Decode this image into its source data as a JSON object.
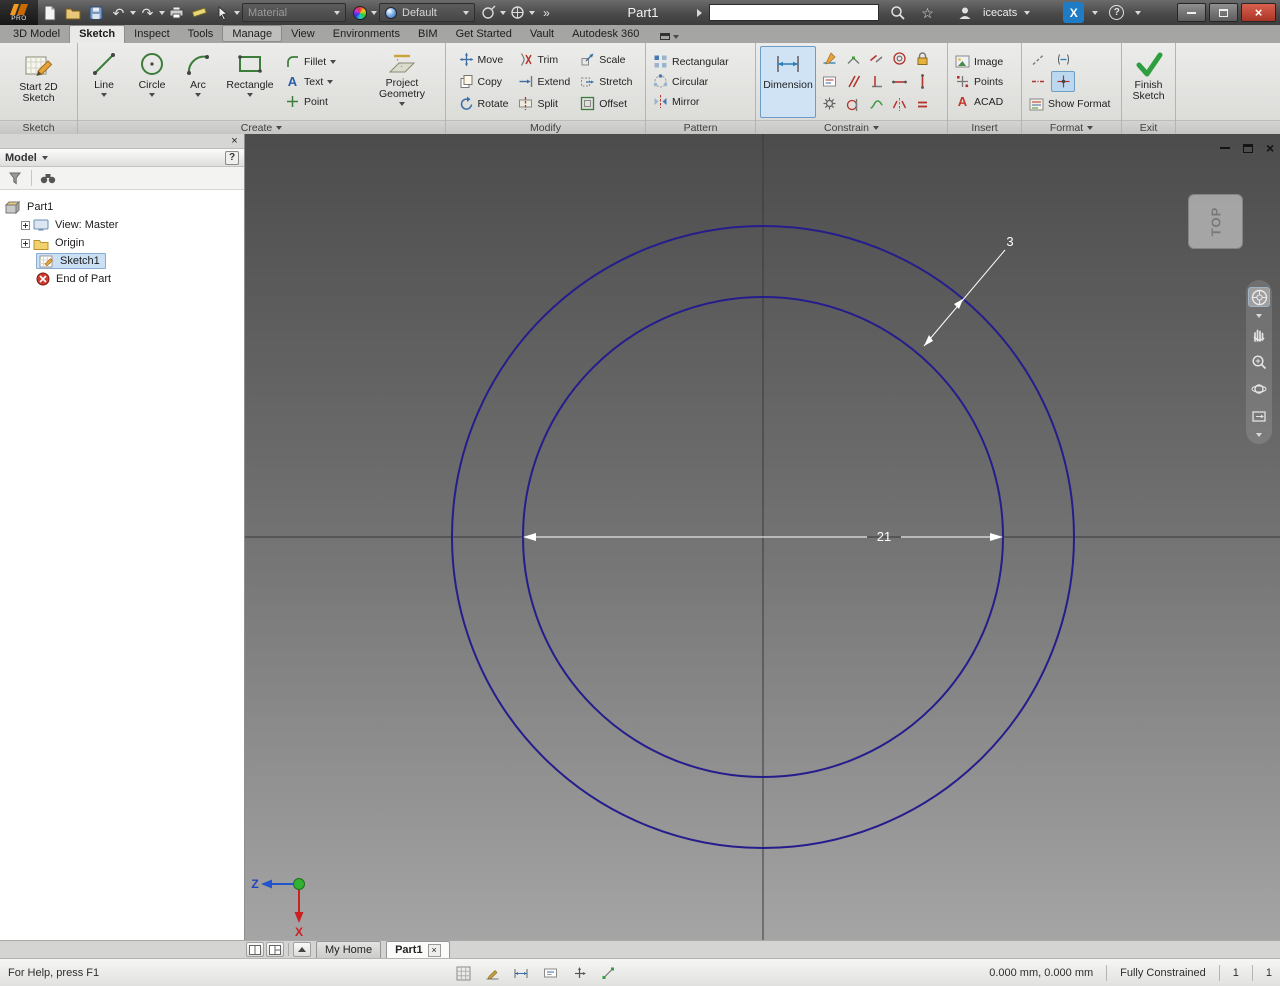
{
  "colors": {
    "circle_stroke": "#251d8c",
    "canvas_top": "#4c4c4c",
    "canvas_bottom": "#a5a5a5",
    "dimension_white": "#ffffff",
    "finish_green": "#2e9e3e",
    "selection_blue": "#cbe0f5",
    "exchange_blue": "#1e7bc4",
    "close_button_red": "#b03a2a"
  },
  "icons": {
    "close": "×",
    "minimize": "–",
    "help": "?",
    "overflow": "»",
    "star": "☆",
    "undo": "↶",
    "redo": "↷",
    "exchange_glyph": "X",
    "acad_glyph": "A",
    "text_tool_glyph": "A"
  },
  "titlebar": {
    "pro_badge": "PRO",
    "material_combo": "Material",
    "appearance_combo": "Default",
    "doc_title": "Part1",
    "search_value": "",
    "user": "icecats"
  },
  "ribbon_tabs": [
    {
      "label": "3D Model"
    },
    {
      "label": "Sketch"
    },
    {
      "label": "Inspect"
    },
    {
      "label": "Tools"
    },
    {
      "label": "Manage"
    },
    {
      "label": "View"
    },
    {
      "label": "Environments"
    },
    {
      "label": "BIM"
    },
    {
      "label": "Get Started"
    },
    {
      "label": "Vault"
    },
    {
      "label": "Autodesk 360"
    }
  ],
  "ribbon": {
    "sketch": {
      "label": "Sketch",
      "start2d": "Start 2D Sketch"
    },
    "create": {
      "label": "Create",
      "line": "Line",
      "circle": "Circle",
      "arc": "Arc",
      "rectangle": "Rectangle",
      "fillet": "Fillet",
      "text": "Text",
      "point": "Point",
      "project": "Project Geometry"
    },
    "modify": {
      "label": "Modify",
      "move": "Move",
      "copy": "Copy",
      "rotate": "Rotate",
      "trim": "Trim",
      "extend": "Extend",
      "split": "Split",
      "scale": "Scale",
      "stretch": "Stretch",
      "offset": "Offset"
    },
    "pattern": {
      "label": "Pattern",
      "rectangular": "Rectangular",
      "circular": "Circular",
      "mirror": "Mirror"
    },
    "constrain": {
      "label": "Constrain",
      "dimension": "Dimension"
    },
    "insert": {
      "label": "Insert",
      "image": "Image",
      "points": "Points",
      "acad": "ACAD"
    },
    "format": {
      "label": "Format",
      "show_format": "Show Format"
    },
    "exit": {
      "label": "Exit",
      "finish": "Finish Sketch"
    }
  },
  "browser": {
    "title": "Model",
    "tree": [
      {
        "label": "Part1"
      },
      {
        "label": "View: Master"
      },
      {
        "label": "Origin"
      },
      {
        "label": "Sketch1"
      },
      {
        "label": "End of Part"
      }
    ]
  },
  "canvas": {
    "viewcube_face": "TOP",
    "dim_diameter": "21",
    "dim_gap": "3",
    "axis_z": "Z",
    "axis_x": "X"
  },
  "doc_tabs": [
    {
      "label": "My Home"
    },
    {
      "label": "Part1"
    }
  ],
  "statusbar": {
    "help": "For Help, press F1",
    "coords": "0.000 mm, 0.000 mm",
    "constraint_status": "Fully Constrained",
    "dimensions_needed": "1",
    "doc_count": "1"
  }
}
